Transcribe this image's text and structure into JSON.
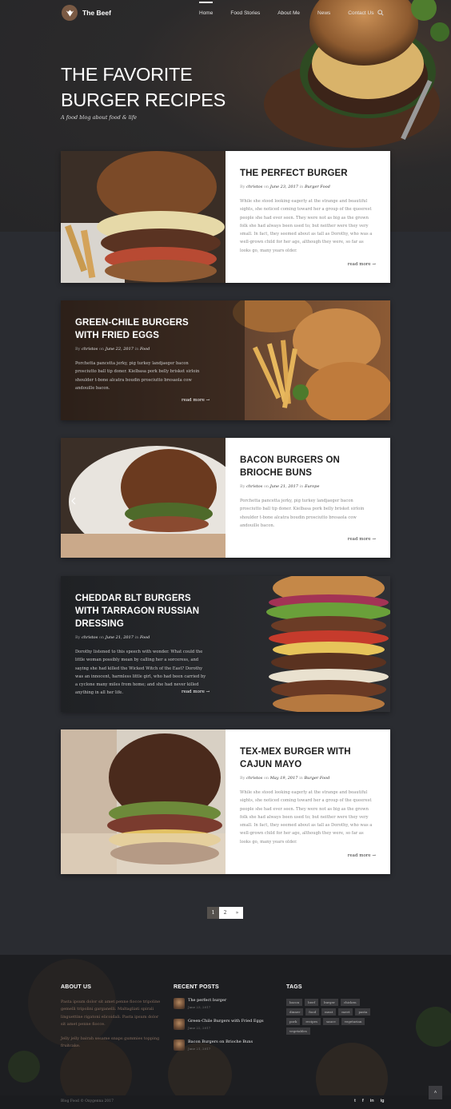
{
  "nav": {
    "brand": "The Beef",
    "links": [
      "Home",
      "Food Stories",
      "About Me",
      "News",
      "Contact Us"
    ]
  },
  "hero": {
    "title": "THE FAVORITE BURGER RECIPES",
    "subtitle": "A food blog about food & life"
  },
  "posts": [
    {
      "title": "THE PERFECT BURGER",
      "by": "By",
      "author": "christos",
      "on": "on",
      "date": "June 23, 2017",
      "in": "in",
      "category": "Burger Food",
      "excerpt": "While she stood looking eagerly at the strange and beautiful sights, she noticed coming toward her a group of the queerest people she had ever seen. They were not as big as the grown folk she had always been used to; but neither were they very small. In fact, they seemed about as tall as Dorothy, who was a well-grown child for her age, although they were, so far as looks go, many years older.",
      "read_more": "read more →"
    },
    {
      "title": "GREEN-CHILE BURGERS WITH FRIED EGGS",
      "by": "By",
      "author": "christos",
      "on": "on",
      "date": "June 22, 2017",
      "in": "in",
      "category": "Food",
      "excerpt": "Porchetta pancetta jerky, pig turkey landjaeger bacon prosciutto ball tip doner. Kielbasa pork belly brisket sirloin shoulder t-bone alcatra boudin prosciutto bresaola cow andouille bacon.",
      "read_more": "read more →"
    },
    {
      "title": "BACON BURGERS ON BRIOCHE BUNS",
      "by": "By",
      "author": "christos",
      "on": "on",
      "date": "June 21, 2017",
      "in": "in",
      "category": "Europe",
      "excerpt": "Porchetta pancetta jerky, pig turkey landjaeger bacon prosciutto ball tip doner. Kielbasa pork belly brisket sirloin shoulder t-bone alcatra boudin prosciutto bresaola cow andouille bacon.",
      "read_more": "read more →"
    },
    {
      "title": "CHEDDAR BLT BURGERS WITH TARRAGON RUSSIAN DRESSING",
      "by": "By",
      "author": "christos",
      "on": "on",
      "date": "June 21, 2017",
      "in": "in",
      "category": "Food",
      "excerpt": "Dorothy listened to this speech with wonder. What could the little woman possibly mean by calling her a sorceress, and saying she had killed the Wicked Witch of the East? Dorothy was an innocent, harmless little girl, who had been carried by a cyclone many miles from home; and she had never killed anything in all her life.",
      "read_more": "read more →"
    },
    {
      "title": "TEX-MEX BURGER WITH CAJUN MAYO",
      "by": "By",
      "author": "christos",
      "on": "on",
      "date": "May 19, 2017",
      "in": "in",
      "category": "Burger Food",
      "excerpt": "While she stood looking eagerly at the strange and beautiful sights, she noticed coming toward her a group of the queerest people she had ever seen. They were not as big as the grown folk she had always been used to; but neither were they very small. In fact, they seemed about as tall as Dorothy, who was a well-grown child for her age, although they were, so far as looks go, many years older.",
      "read_more": "read more →"
    }
  ],
  "pagination": {
    "pages": [
      "1",
      "2",
      "»"
    ]
  },
  "footer": {
    "about_heading": "ABOUT US",
    "about_p1": "Pasta ipsum dolor sit amet penne fiocce tripoline gemelli tripolini garganelli. Maltagliati spirali linguettine rigatoni elicoidali. Pasta ipsum dolor sit amet penne fiocce.",
    "about_p2": "Jelly jelly bairah sesame snaps gummies topping fruitcake.",
    "recent_heading": "RECENT POSTS",
    "recent": [
      {
        "title": "The perfect burger",
        "date": "June 23, 2017"
      },
      {
        "title": "Green-Chile Burgers with Fried Eggs",
        "date": "June 22, 2017"
      },
      {
        "title": "Bacon Burgers on Brioche Buns",
        "date": "June 21, 2017"
      }
    ],
    "tags_heading": "TAGS",
    "tags": [
      "bacon",
      "beef",
      "burger",
      "chicken",
      "dinner",
      "food",
      "meat",
      "meet",
      "pasta",
      "pork",
      "recipes",
      "sauce",
      "vegetarian",
      "vegetables"
    ],
    "copyright": "Blog Food © Oxygenna 2017",
    "socials": [
      "t",
      "f",
      "in",
      "ig"
    ],
    "to_top": "˄"
  },
  "colors": {
    "accent": "#7a5a44",
    "footer_text": "#8a7060",
    "bg": "#2a2c31"
  }
}
